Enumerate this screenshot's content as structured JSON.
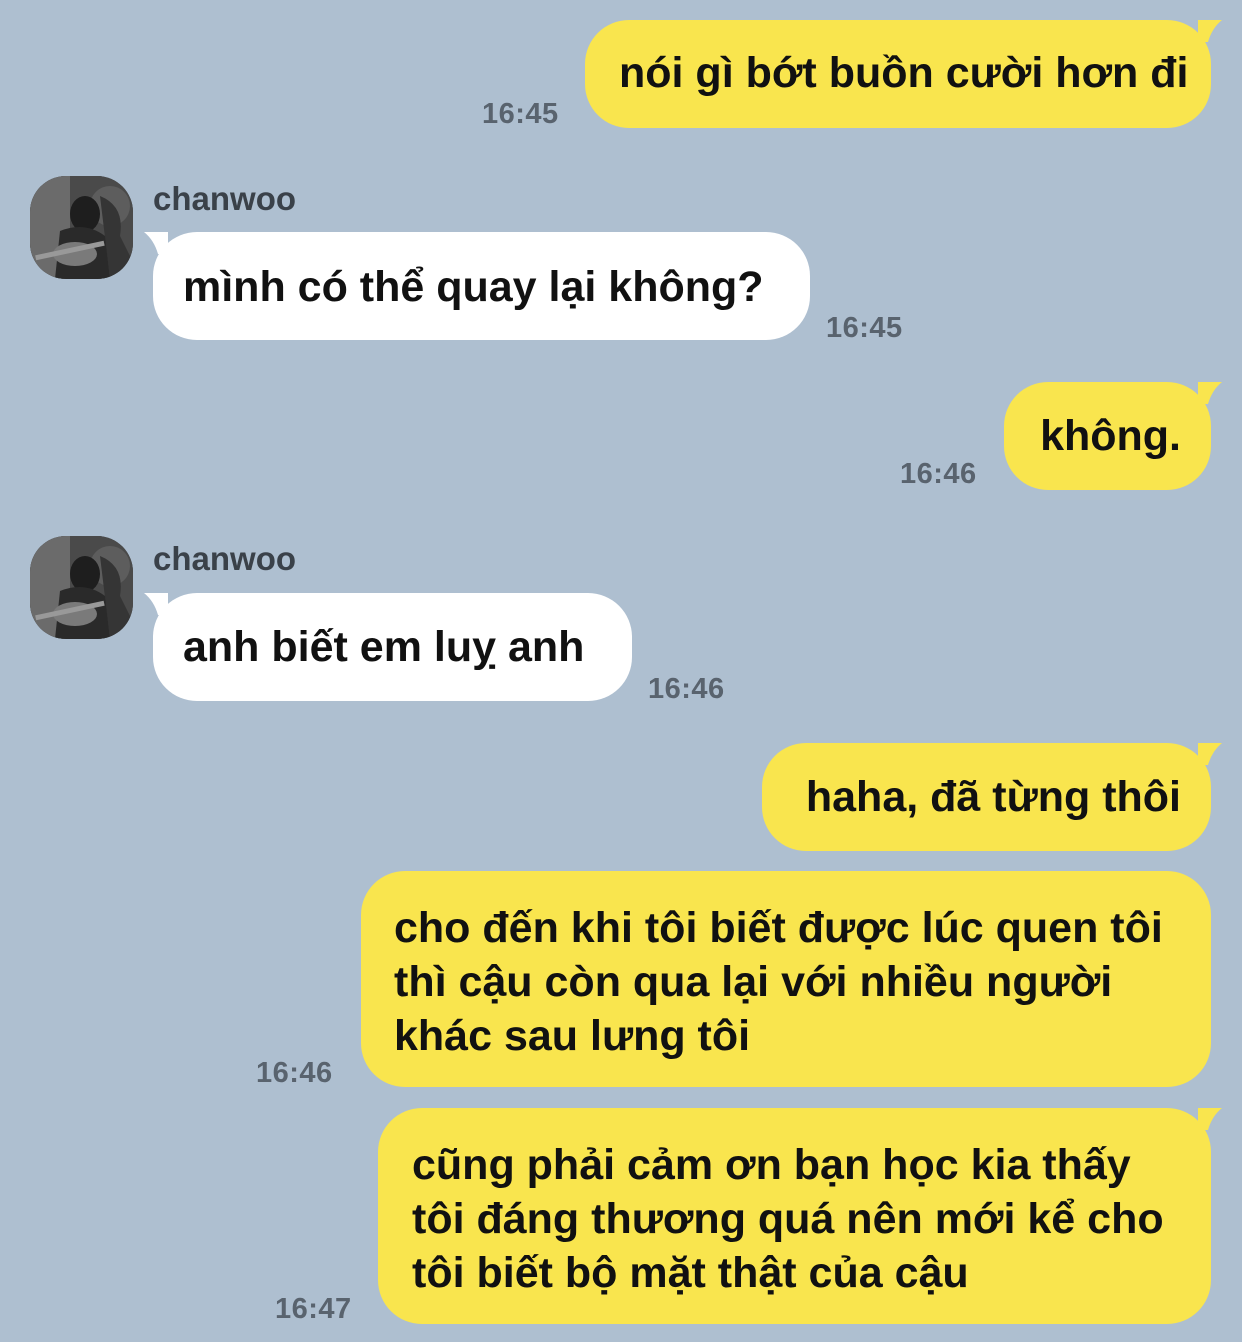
{
  "contact": {
    "name": "chanwoo"
  },
  "colors": {
    "background": "#aebfd0",
    "my_bubble": "#f9e54e",
    "their_bubble": "#ffffff",
    "timestamp": "#59636e"
  },
  "messages": [
    {
      "from": "me",
      "text": "nói gì bớt buồn cười hơn đi",
      "time": "16:45"
    },
    {
      "from": "chanwoo",
      "sender_label": "chanwoo",
      "text": "mình có thể quay lại không?",
      "time": "16:45"
    },
    {
      "from": "me",
      "text": "không.",
      "time": "16:46"
    },
    {
      "from": "chanwoo",
      "sender_label": "chanwoo",
      "text": "anh biết em luỵ anh",
      "time": "16:46"
    },
    {
      "from": "me",
      "text": "haha, đã từng thôi",
      "time": ""
    },
    {
      "from": "me",
      "text": "cho đến khi tôi biết được lúc quen tôi thì cậu còn qua lại với nhiều người khác sau lưng tôi",
      "time": "16:46"
    },
    {
      "from": "me",
      "text": "cũng phải cảm ơn bạn học kia thấy tôi đáng thương quá nên mới kể cho tôi biết bộ mặt thật của cậu",
      "time": "16:47"
    }
  ]
}
